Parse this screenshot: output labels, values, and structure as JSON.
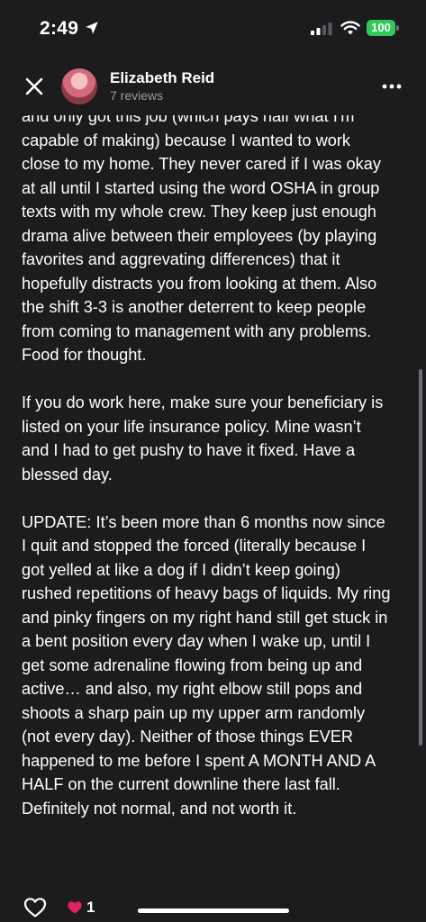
{
  "status_bar": {
    "time": "2:49",
    "battery": "100"
  },
  "header": {
    "name": "Elizabeth Reid",
    "reviews": "7 reviews"
  },
  "review": {
    "paragraphs": [
      "and only got this job (which pays half what I'm capable of making) because I wanted to work close to my home. They never cared if I was okay at all until I started using the word OSHA in group texts with my whole crew. They keep just enough drama alive between their employees (by playing favorites and aggrevating differences) that it hopefully distracts you from looking at them. Also the shift 3-3 is another deterrent to keep people from coming to management with any problems. Food for thought.",
      "If you do work here, make sure your beneficiary is listed on your life insurance policy. Mine wasn’t and I had to get pushy to have it fixed. Have a blessed day.",
      "UPDATE: It’s been more than 6 months now since I quit and stopped the forced (literally because I got yelled at like a dog if I didn’t keep going) rushed repetitions of heavy bags of liquids. My ring and pinky fingers on my right hand still get stuck in a bent position every day when I wake up, until I get some adrenaline flowing from being up and active… and also, my right elbow still pops and shoots a sharp pain up my upper arm randomly (not every day). Neither of those things EVER happened to me before I spent A MONTH AND A HALF on the current downline there last fall. Definitely not normal, and not worth it."
    ]
  },
  "footer": {
    "like_count": "1"
  },
  "colors": {
    "background": "#1c1c1e",
    "battery": "#34c759",
    "like_heart": "#e0245e"
  },
  "icons": [
    "location-arrow-icon",
    "signal-icon",
    "wifi-icon",
    "close-icon",
    "more-icon",
    "heart-outline-icon",
    "heart-filled-icon"
  ]
}
